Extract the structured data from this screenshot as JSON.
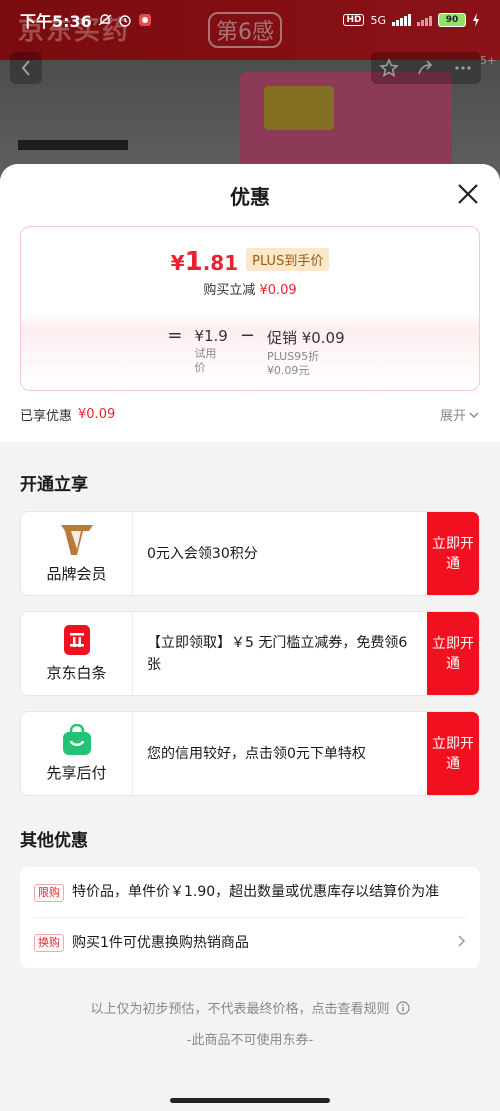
{
  "status_bar": {
    "time": "下午5:36",
    "network": "5G",
    "hd": "HD",
    "battery": "90"
  },
  "background": {
    "logo_text": "京东买药",
    "brand_text": "第6感",
    "photo_count": "5+"
  },
  "sheet": {
    "title": "优惠",
    "price_card": {
      "final_currency": "¥",
      "final_integer": "1",
      "final_decimal": ".81",
      "plus_tag": "PLUS到手价",
      "save_label": "购买立减",
      "save_amount": "¥0.09",
      "equals": "=",
      "trial_price": "¥1.9",
      "trial_label": "试用价",
      "minus": "−",
      "promo_label": "促销 ¥0.09",
      "promo_detail_1": "PLUS95折",
      "promo_detail_2": "¥0.09元"
    },
    "enjoyed_label": "已享优惠",
    "enjoyed_amount": "¥0.09",
    "expand_label": "展开"
  },
  "open_section": {
    "title": "开通立享",
    "cards": [
      {
        "name": "品牌会员",
        "icon": "v-brand-icon",
        "desc": "0元入会领30积分",
        "button": "立即开通"
      },
      {
        "name": "京东白条",
        "icon": "baitiao-icon",
        "desc": "【立即领取】￥5 无门槛立减券，免费领6张",
        "button": "立即开通"
      },
      {
        "name": "先享后付",
        "icon": "shopping-bag-icon",
        "desc": "您的信用较好，点击领0元下单特权",
        "button": "立即开通"
      }
    ]
  },
  "other_section": {
    "title": "其他优惠",
    "rows": [
      {
        "tag": "限购",
        "text": "特价品，单件价￥1.90，超出数量或优惠库存以结算价为准"
      },
      {
        "tag": "换购",
        "text": "购买1件可优惠换购热销商品"
      }
    ]
  },
  "footer": {
    "note": "以上仅为初步预估，不代表最终价格，点击查看规则",
    "note2": "-此商品不可使用东券-"
  },
  "colors": {
    "accent_red": "#e8232f",
    "button_red": "#f0101f",
    "plus_bg": "#fbe8c8"
  }
}
